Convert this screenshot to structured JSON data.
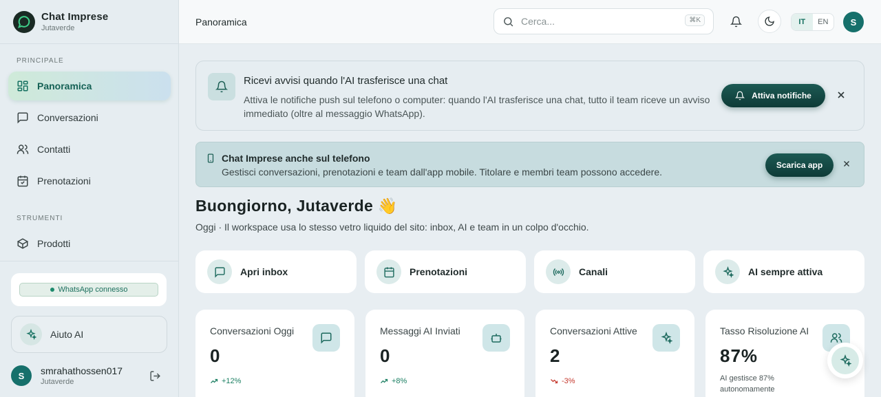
{
  "app": {
    "name": "Chat Imprese",
    "workspace": "Jutaverde"
  },
  "sidebar": {
    "sections": [
      {
        "label": "PRINCIPALE",
        "items": [
          {
            "label": "Panoramica",
            "icon": "grid-icon",
            "active": true
          },
          {
            "label": "Conversazioni",
            "icon": "message-icon"
          },
          {
            "label": "Contatti",
            "icon": "users-icon"
          },
          {
            "label": "Prenotazioni",
            "icon": "calendar-icon"
          }
        ]
      },
      {
        "label": "STRUMENTI",
        "items": [
          {
            "label": "Prodotti",
            "icon": "box-icon"
          }
        ]
      }
    ],
    "whatsapp_status": "WhatsApp connesso",
    "help_label": "Aiuto AI",
    "user": {
      "name": "smrahathossen017",
      "org": "Jutaverde",
      "initial": "S"
    }
  },
  "topbar": {
    "title": "Panoramica",
    "search_placeholder": "Cerca...",
    "shortcut": "⌘K",
    "languages": [
      "IT",
      "EN"
    ],
    "active_language": "IT",
    "avatar_initial": "S"
  },
  "notification_banner": {
    "title": "Ricevi avvisi quando l'AI trasferisce una chat",
    "text": "Attiva le notifiche push sul telefono o computer: quando l'AI trasferisce una chat, tutto il team riceve un avviso immediato (oltre al messaggio WhatsApp).",
    "button": "Attiva notifiche"
  },
  "app_banner": {
    "title": "Chat Imprese anche sul telefono",
    "text": "Gestisci conversazioni, prenotazioni e team dall'app mobile. Titolare e membri team possono accedere.",
    "button": "Scarica app"
  },
  "greeting": {
    "title": "Buongiorno, Jutaverde 👋",
    "subtitle": "Oggi · Il workspace usa lo stesso vetro liquido del sito: inbox, AI e team in un colpo d'occhio."
  },
  "quick_actions": [
    {
      "label": "Apri inbox",
      "icon": "message-icon"
    },
    {
      "label": "Prenotazioni",
      "icon": "calendar-icon"
    },
    {
      "label": "Canali",
      "icon": "broadcast-icon"
    },
    {
      "label": "AI sempre attiva",
      "icon": "sparkles-icon"
    }
  ],
  "stats": [
    {
      "label": "Conversazioni Oggi",
      "value": "0",
      "trend": "+12%",
      "direction": "up",
      "icon": "message-icon"
    },
    {
      "label": "Messaggi AI Inviati",
      "value": "0",
      "trend": "+8%",
      "direction": "up",
      "icon": "bot-icon"
    },
    {
      "label": "Conversazioni Attive",
      "value": "2",
      "trend": "-3%",
      "direction": "down",
      "icon": "sparkles-icon"
    },
    {
      "label": "Tasso Risoluzione AI",
      "value": "87%",
      "note": "AI gestisce 87% autonomamente",
      "icon": "users-icon"
    }
  ],
  "colors": {
    "accent": "#157060",
    "dark_button": "#0e3b37",
    "trend_up": "#1b7f62",
    "trend_down": "#c5392e"
  }
}
